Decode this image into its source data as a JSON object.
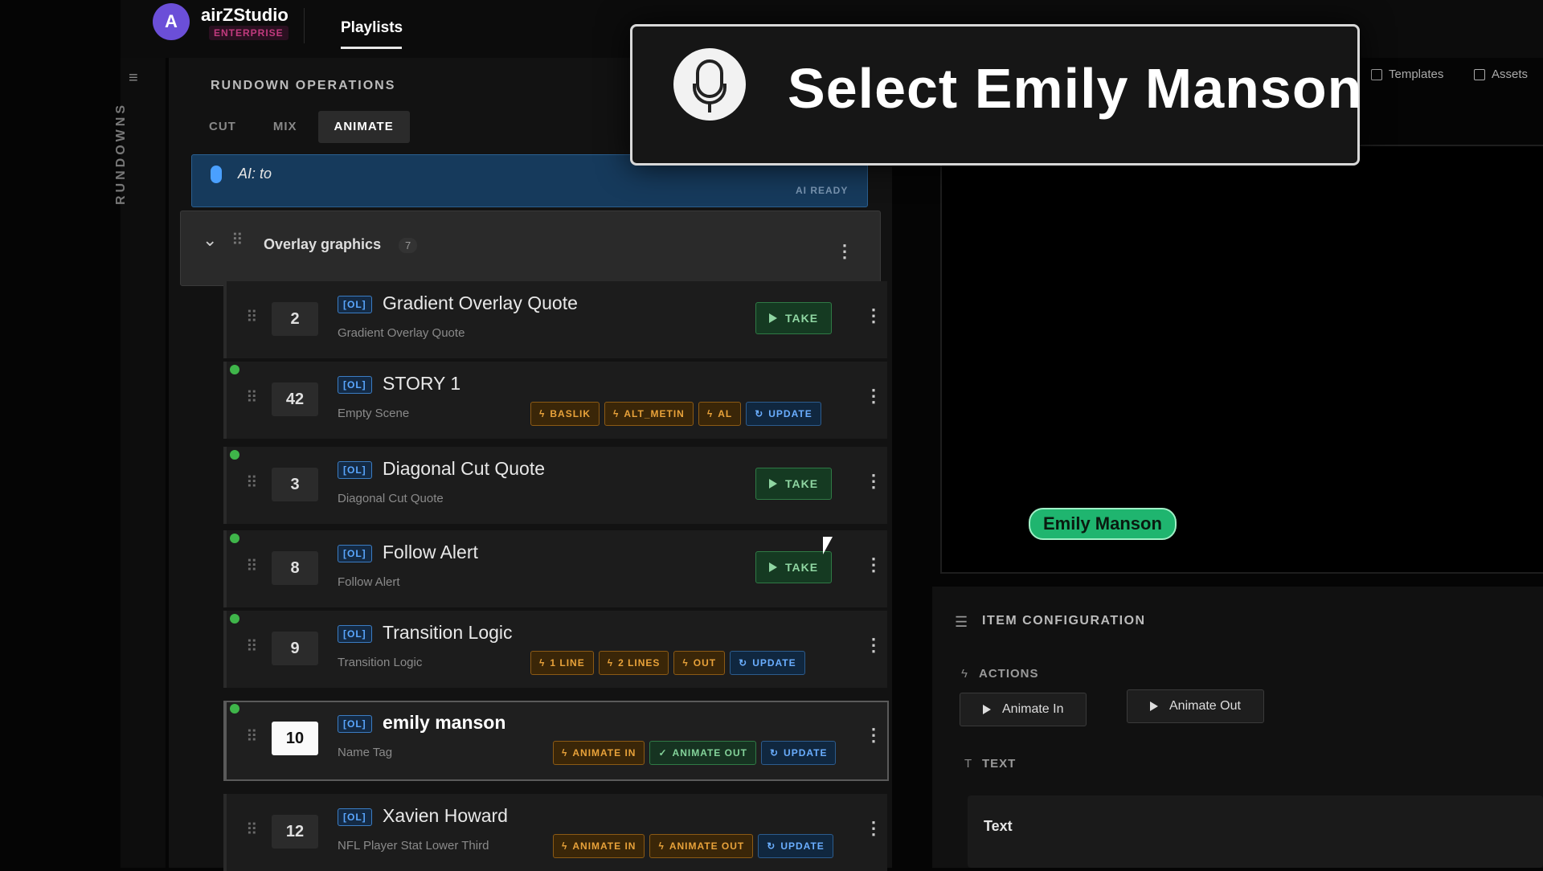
{
  "app": {
    "name": "airZStudio",
    "edition": "ENTERPRISE",
    "avatar_letter": "A",
    "nav_tab": "Playlists"
  },
  "top_links": {
    "templates": "Templates",
    "assets": "Assets"
  },
  "rail": {
    "label": "RUNDOWNS"
  },
  "rundown": {
    "section_title": "RUNDOWN OPERATIONS",
    "modes": [
      "CUT",
      "MIX",
      "ANIMATE"
    ],
    "active_mode": "ANIMATE",
    "ai_input": "AI: to",
    "ai_status": "AI READY",
    "group": {
      "title": "Overlay graphics",
      "count": "7"
    },
    "items": [
      {
        "num": "2",
        "tag": "[OL]",
        "title": "Gradient Overlay Quote",
        "sub": "Gradient Overlay Quote",
        "live": false,
        "take": "TAKE"
      },
      {
        "num": "42",
        "tag": "[OL]",
        "title": "STORY 1",
        "sub": "Empty Scene",
        "live": true,
        "chips": [
          {
            "label": "BASLIK",
            "kind": "amber"
          },
          {
            "label": "ALT_METIN",
            "kind": "amber"
          },
          {
            "label": "AL",
            "kind": "amber"
          },
          {
            "label": "UPDATE",
            "kind": "blue"
          }
        ]
      },
      {
        "num": "3",
        "tag": "[OL]",
        "title": "Diagonal Cut Quote",
        "sub": "Diagonal Cut Quote",
        "live": true,
        "take": "TAKE"
      },
      {
        "num": "8",
        "tag": "[OL]",
        "title": "Follow Alert",
        "sub": "Follow Alert",
        "live": true,
        "take": "TAKE"
      },
      {
        "num": "9",
        "tag": "[OL]",
        "title": "Transition Logic",
        "sub": "Transition Logic",
        "live": true,
        "chips": [
          {
            "label": "1 LINE",
            "kind": "amber"
          },
          {
            "label": "2 LINES",
            "kind": "amber"
          },
          {
            "label": "OUT",
            "kind": "amber"
          },
          {
            "label": "UPDATE",
            "kind": "blue"
          }
        ]
      },
      {
        "num": "10",
        "tag": "[OL]",
        "title": "emily manson",
        "sub": "Name Tag",
        "live": true,
        "selected": true,
        "chips": [
          {
            "label": "ANIMATE IN",
            "kind": "amber"
          },
          {
            "label": "ANIMATE OUT",
            "kind": "green"
          },
          {
            "label": "UPDATE",
            "kind": "blue"
          }
        ]
      },
      {
        "num": "12",
        "tag": "[OL]",
        "title": "Xavien Howard",
        "sub": "NFL Player Stat Lower Third",
        "live": false,
        "chips": [
          {
            "label": "ANIMATE IN",
            "kind": "amber"
          },
          {
            "label": "ANIMATE OUT",
            "kind": "amber"
          },
          {
            "label": "UPDATE",
            "kind": "blue"
          }
        ]
      }
    ]
  },
  "preview": {
    "name_badge": "Emily Manson"
  },
  "config": {
    "title": "ITEM CONFIGURATION",
    "actions_title": "ACTIONS",
    "animate_in": "Animate In",
    "animate_out": "Animate Out",
    "text_title": "TEXT",
    "text_field_label": "Text"
  },
  "voice_command": {
    "text": "Select Emily Manson"
  }
}
